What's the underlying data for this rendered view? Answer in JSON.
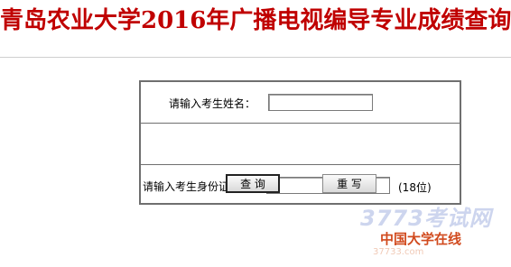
{
  "header": {
    "title": "青岛农业大学2016年广播电视编导专业成绩查询",
    "title_color": "#c00000"
  },
  "form": {
    "name_label": "请输入考生姓名：",
    "name_value": "",
    "id_label": "请输入考生身份证号：",
    "id_value": "",
    "id_hint": "(18位)",
    "query_button": "查 询",
    "reset_button": "重 写"
  },
  "watermark": {
    "logo": "3773考试网",
    "text": "中国大学在线",
    "sub": "37733.com"
  }
}
